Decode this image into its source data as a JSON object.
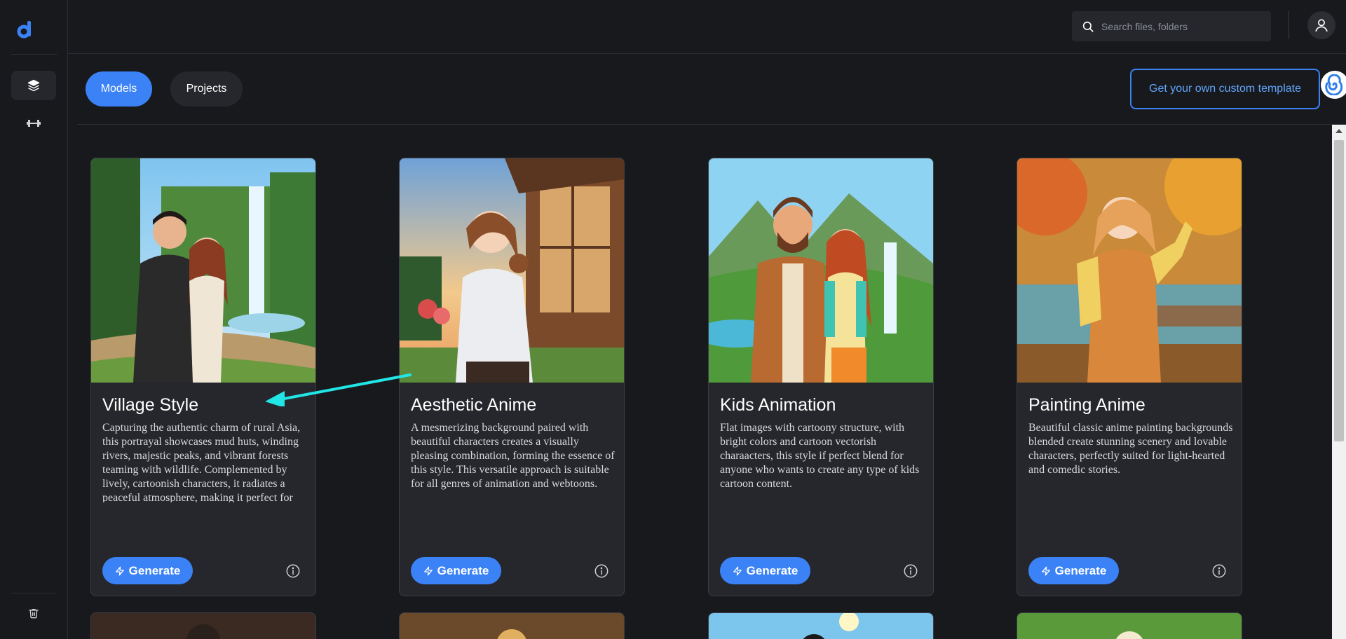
{
  "search": {
    "placeholder": "Search files, folders"
  },
  "tabs": [
    {
      "label": "Models",
      "active": true
    },
    {
      "label": "Projects",
      "active": false
    }
  ],
  "custom_template_label": "Get your own custom template",
  "cards": [
    {
      "title": "Village Style",
      "description": "Capturing the authentic charm of rural Asia, this portrayal showcases mud huts, winding rivers, majestic peaks, and vibrant forests teaming with wildlife. Complemented by lively, cartoonish characters, it radiates a peaceful atmosphere, making it perfect for",
      "button": "Generate"
    },
    {
      "title": "Aesthetic Anime",
      "description": "A mesmerizing background paired with beautiful characters creates a visually pleasing combination, forming the essence of this style. This versatile approach is suitable for all genres of animation and webtoons.",
      "button": "Generate"
    },
    {
      "title": "Kids Animation",
      "description": "Flat images with cartoony structure, with bright colors and cartoon vectorish charaacters, this style if perfect blend for anyone who wants to create any type of kids cartoon content.",
      "button": "Generate"
    },
    {
      "title": "Painting Anime",
      "description": "Beautiful classic anime painting backgrounds blended create stunning scenery and lovable characters, perfectly suited for light-hearted and comedic stories.",
      "button": "Generate"
    }
  ],
  "colors": {
    "accent": "#3b82f6",
    "background": "#18191d",
    "card": "#25272c",
    "arrow": "#22e5e5"
  },
  "icons": [
    "logo-icon",
    "layers-icon",
    "dumbbell-icon",
    "trash-icon",
    "search-icon",
    "user-icon",
    "spiral-icon",
    "lightning-icon",
    "info-icon"
  ]
}
